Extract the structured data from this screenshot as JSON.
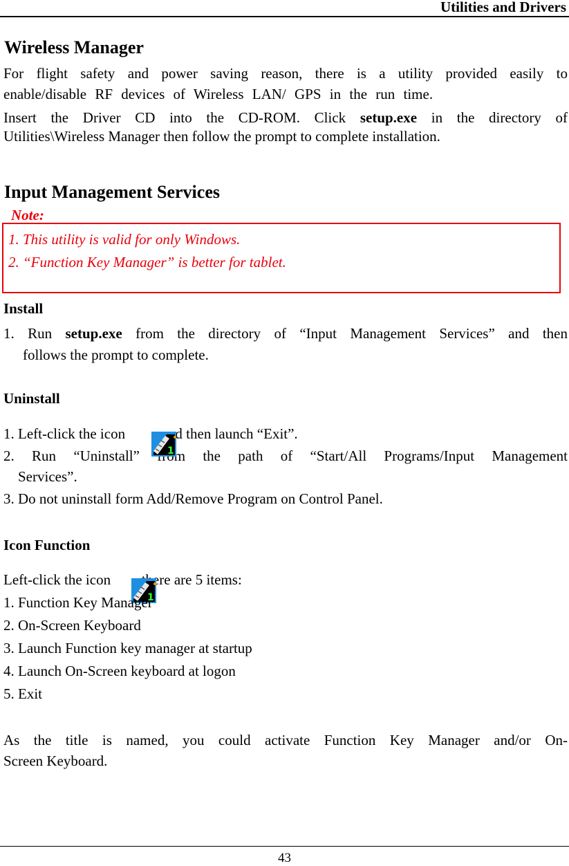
{
  "header": {
    "title": "Utilities and Drivers"
  },
  "wireless": {
    "heading": "Wireless Manager",
    "para1_line1": "For flight safety and power saving reason, there is a utility provided easily to",
    "para1_line2": "enable/disable RF devices of Wireless LAN/ GPS in the run time.",
    "para2_line1_a": "Insert the Driver CD into the CD-ROM. Click ",
    "para2_line1_bold": "setup.exe",
    "para2_line1_b": " in the directory of",
    "para2_line2": "Utilities\\Wireless Manager then follow the prompt to complete installation."
  },
  "ims": {
    "heading": "Input Management Services",
    "note_label": "Note:",
    "notes": [
      "1. This utility is valid for only Windows.",
      "2. “Function Key Manager” is better for tablet."
    ],
    "note_color": "#e8000b",
    "install": {
      "heading": "Install",
      "step1_a": "1. Run ",
      "step1_bold": "setup.exe",
      "step1_b": " from the directory of “Input Management Services” and then",
      "step1_cont": "follows the prompt to complete."
    },
    "uninstall": {
      "heading": "Uninstall",
      "step1_a": "1. Left-click the icon",
      "step1_b": "and then launch “Exit”.",
      "step2_line1": "2. Run “Uninstall” from the path of “Start/All Programs/Input Management",
      "step2_line2": "Services”.",
      "step3": "3. Do not uninstall form Add/Remove Program on Control Panel."
    },
    "icon_function": {
      "heading": "Icon Function",
      "intro_a": "Left-click the icon",
      "intro_b": ", there are 5 items:",
      "items": [
        "1. Function Key Manager",
        "2. On-Screen Keyboard",
        "3. Launch Function key manager at startup",
        "4. Launch On-Screen keyboard at logon",
        "5. Exit"
      ],
      "closing_line1": "As the title is named, you could activate Function Key Manager and/or On-",
      "closing_line2": "Screen Keyboard."
    }
  },
  "tray_icon": {
    "name": "input-management-tray-icon",
    "badge": "1"
  },
  "footer": {
    "page_number": "43"
  }
}
